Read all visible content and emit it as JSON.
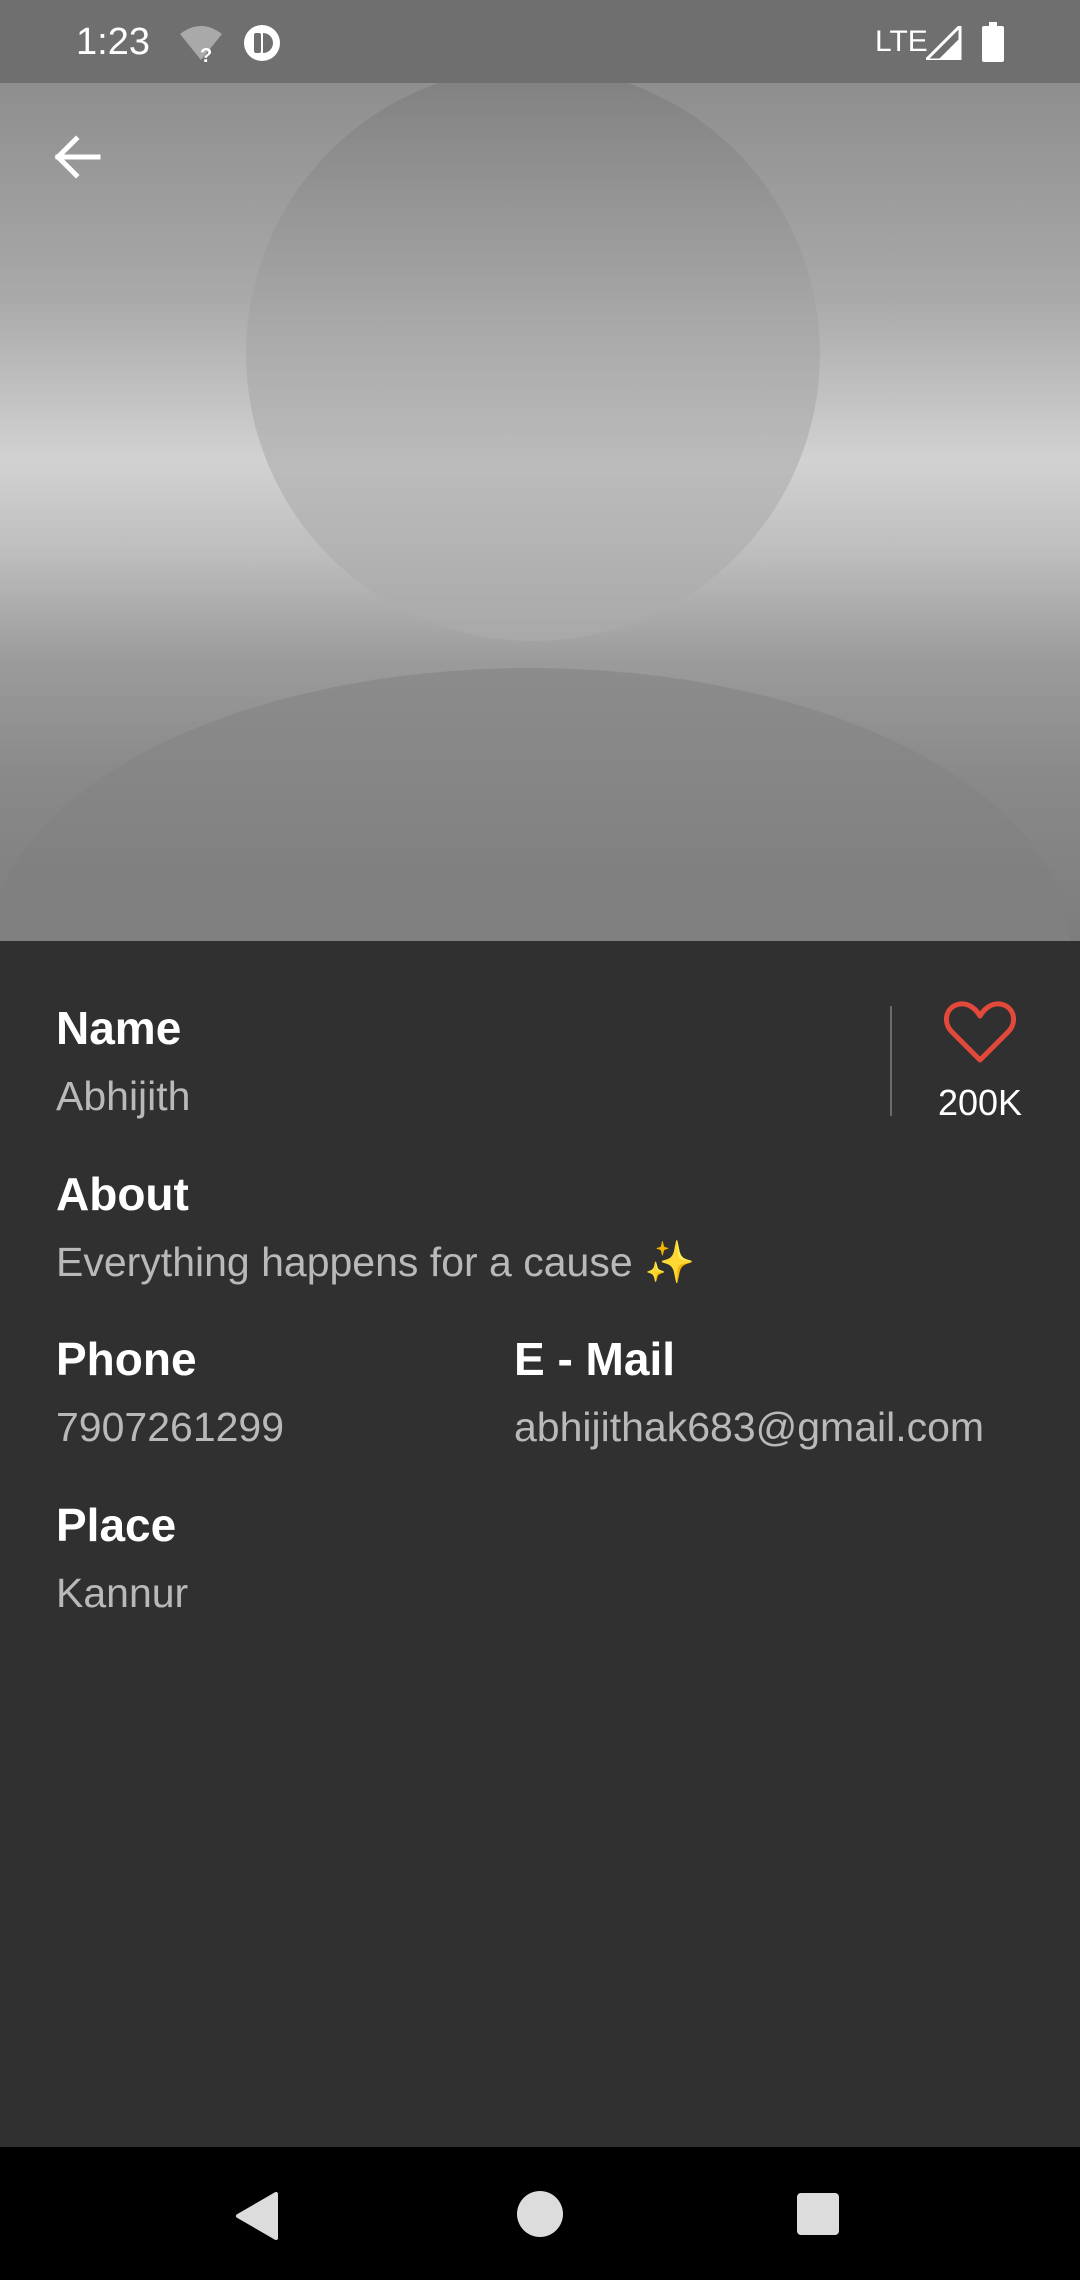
{
  "status_bar": {
    "time": "1:23",
    "network": "LTE",
    "icons": [
      "wifi-unknown-icon",
      "app-notification-icon",
      "signal-icon",
      "battery-icon"
    ]
  },
  "header": {
    "back_icon": "arrow-left-icon",
    "avatar": "default-avatar-silhouette"
  },
  "profile": {
    "name_label": "Name",
    "name_value": "Abhijith",
    "about_label": "About",
    "about_value": "Everything happens for a cause ✨",
    "phone_label": "Phone",
    "phone_value": "7907261299",
    "email_label": "E - Mail",
    "email_value": "abhijithak683@gmail.com",
    "place_label": "Place",
    "place_value": "Kannur"
  },
  "likes": {
    "icon": "heart-outline-icon",
    "count": "200K",
    "color": "#e3493b"
  },
  "nav_bar": {
    "icons": [
      "nav-back-icon",
      "nav-home-icon",
      "nav-recents-icon"
    ]
  }
}
